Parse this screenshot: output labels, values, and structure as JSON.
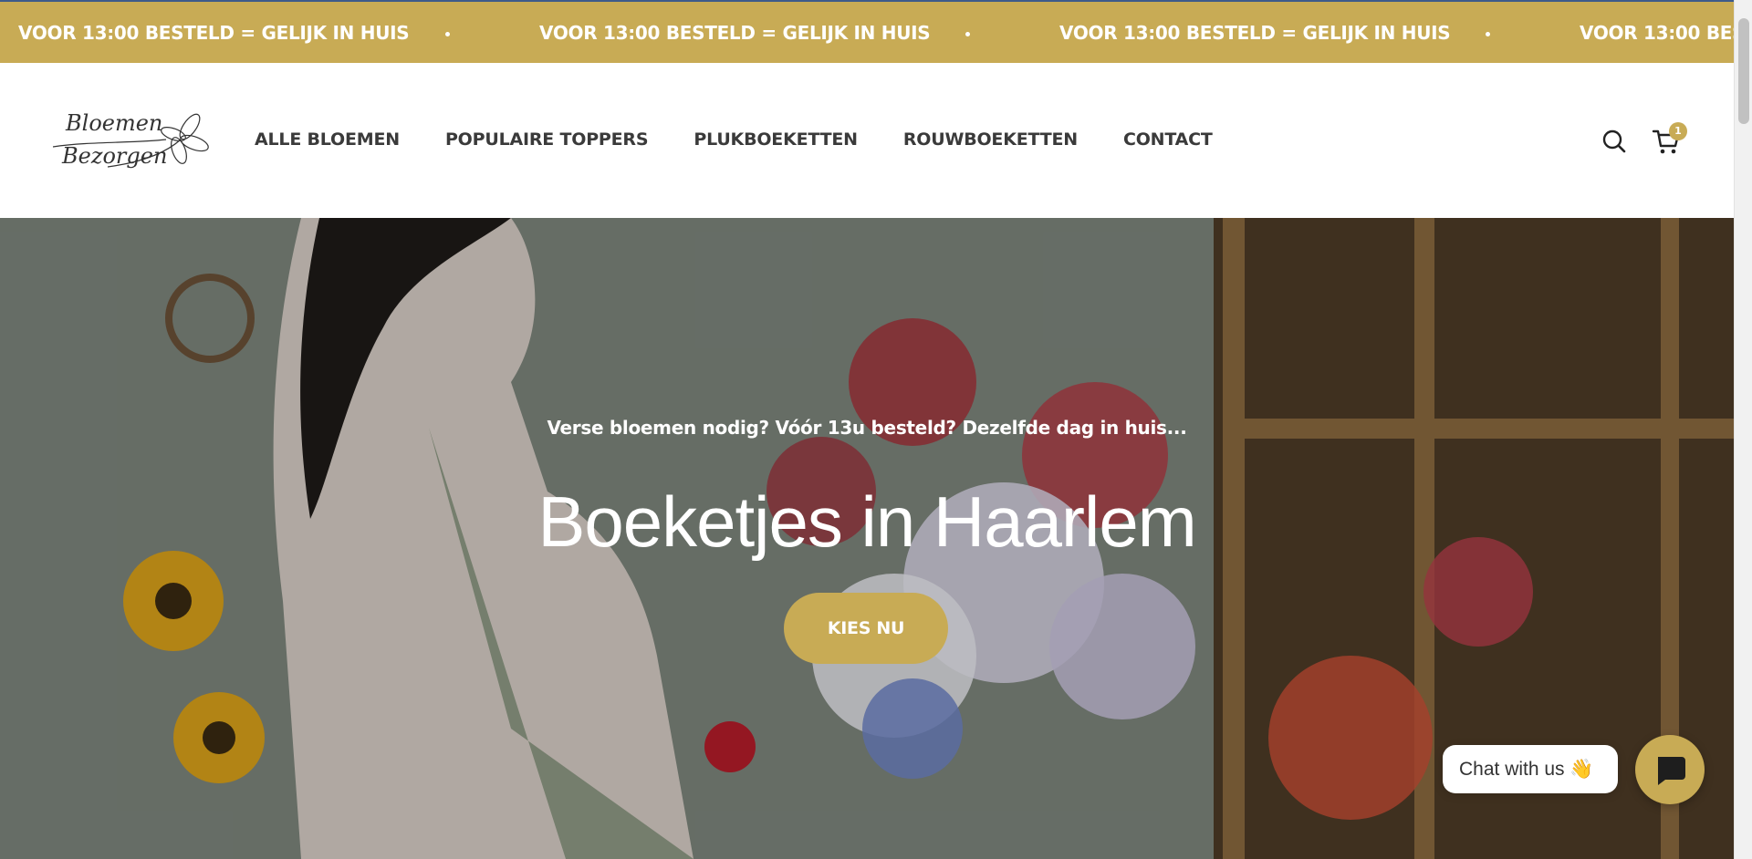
{
  "announcement": {
    "text": "VOOR 13:00 BESTELD = GELIJK IN HUIS"
  },
  "header": {
    "logo_text": [
      "Bloemen",
      "Bezorgen"
    ],
    "nav": [
      {
        "label": "ALLE BLOEMEN"
      },
      {
        "label": "POPULAIRE TOPPERS"
      },
      {
        "label": "PLUKBOEKETTEN"
      },
      {
        "label": "ROUWBOEKETTEN"
      },
      {
        "label": "CONTACT"
      }
    ],
    "cart_count": "1",
    "icons": [
      "search-icon",
      "cart-icon"
    ]
  },
  "hero": {
    "subtitle": "Verse bloemen nodig? Vóór 13u besteld? Dezelfde dag in huis...",
    "title": "Boeketjes in Haarlem",
    "cta": "KIES NU"
  },
  "chat": {
    "label": "Chat with us",
    "emoji": "👋",
    "icon": "chat-icon"
  },
  "colors": {
    "brand": "#c8ab55",
    "text_dark": "#3a3a3a",
    "white": "#ffffff"
  }
}
